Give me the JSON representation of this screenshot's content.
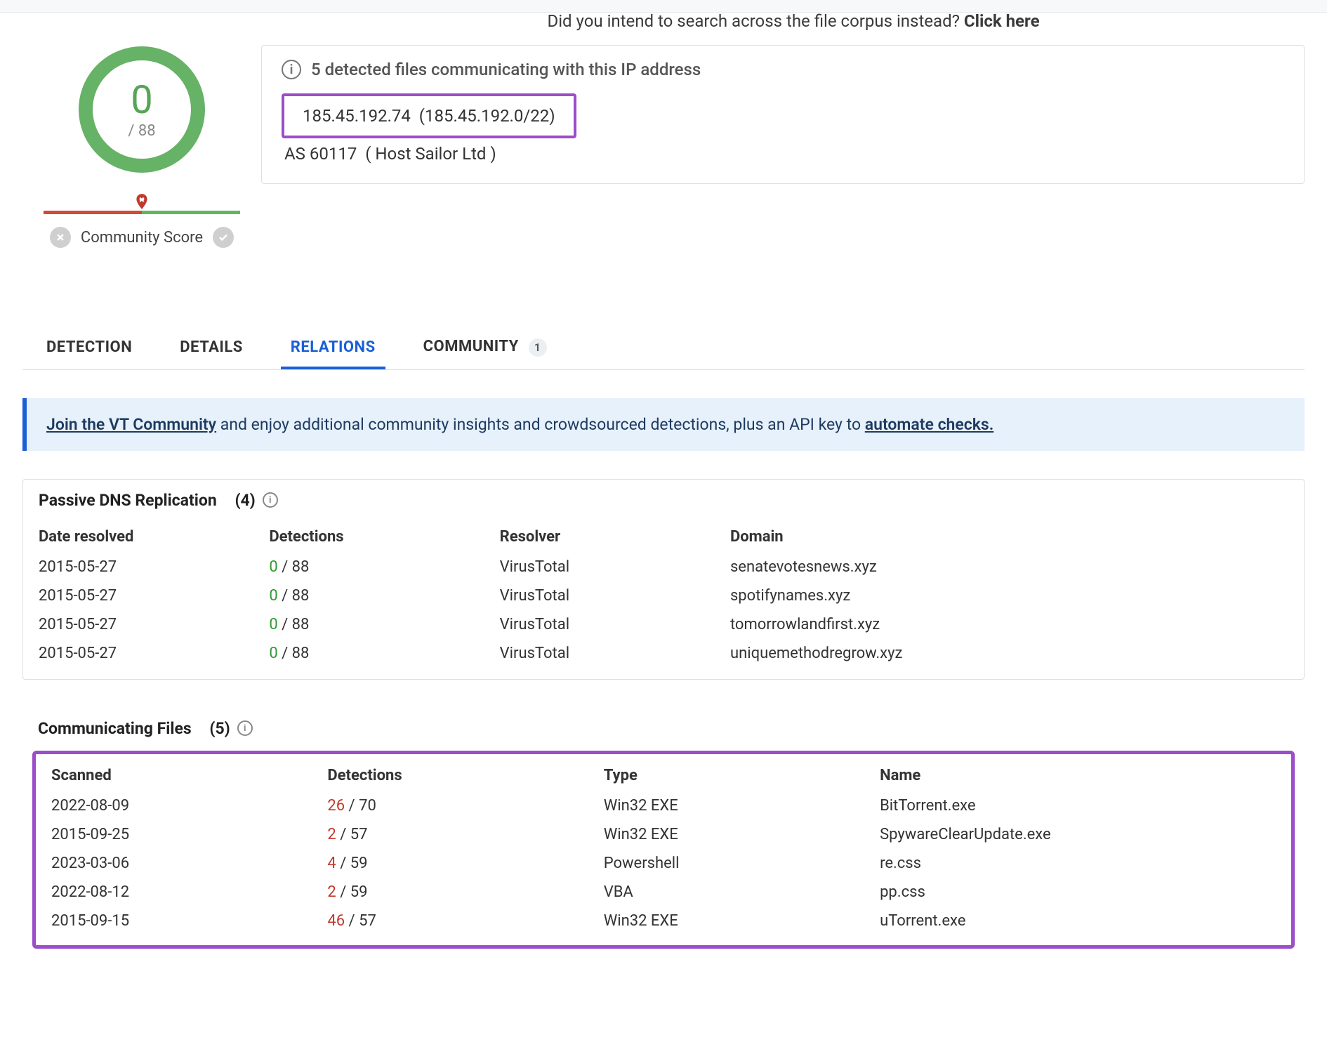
{
  "topHint": {
    "text": "Did you intend to search across the file corpus instead?",
    "linkText": "Click here"
  },
  "score": {
    "detected": "0",
    "total": "/ 88",
    "communityLabel": "Community Score"
  },
  "infoPanel": {
    "notice": "5 detected files communicating with this IP address",
    "ip": "185.45.192.74",
    "cidr": "(185.45.192.0/22)",
    "asn": "AS 60117",
    "asName": "( Host Sailor Ltd )"
  },
  "tabs": {
    "detection": "DETECTION",
    "details": "DETAILS",
    "relations": "RELATIONS",
    "community": "COMMUNITY",
    "communityBadge": "1"
  },
  "promo": {
    "linkA": "Join the VT Community",
    "middle": " and enjoy additional community insights and crowdsourced detections, plus an API key to ",
    "linkB": "automate checks."
  },
  "passiveDns": {
    "title": "Passive DNS Replication",
    "count": "(4)",
    "headers": {
      "date": "Date resolved",
      "det": "Detections",
      "resolver": "Resolver",
      "domain": "Domain"
    },
    "rows": [
      {
        "date": "2015-05-27",
        "det": "0",
        "total": " / 88",
        "resolver": "VirusTotal",
        "domain": "senatevotesnews.xyz"
      },
      {
        "date": "2015-05-27",
        "det": "0",
        "total": " / 88",
        "resolver": "VirusTotal",
        "domain": "spotifynames.xyz"
      },
      {
        "date": "2015-05-27",
        "det": "0",
        "total": " / 88",
        "resolver": "VirusTotal",
        "domain": "tomorrowlandfirst.xyz"
      },
      {
        "date": "2015-05-27",
        "det": "0",
        "total": " / 88",
        "resolver": "VirusTotal",
        "domain": "uniquemethodregrow.xyz"
      }
    ]
  },
  "commFiles": {
    "title": "Communicating Files",
    "count": "(5)",
    "headers": {
      "scanned": "Scanned",
      "det": "Detections",
      "type": "Type",
      "name": "Name"
    },
    "rows": [
      {
        "scanned": "2022-08-09",
        "det": "26",
        "total": " / 70",
        "type": "Win32 EXE",
        "name": "BitTorrent.exe"
      },
      {
        "scanned": "2015-09-25",
        "det": "2",
        "total": " / 57",
        "type": "Win32 EXE",
        "name": "SpywareClearUpdate.exe"
      },
      {
        "scanned": "2023-03-06",
        "det": "4",
        "total": " / 59",
        "type": "Powershell",
        "name": "re.css"
      },
      {
        "scanned": "2022-08-12",
        "det": "2",
        "total": " / 59",
        "type": "VBA",
        "name": "pp.css"
      },
      {
        "scanned": "2015-09-15",
        "det": "46",
        "total": " / 57",
        "type": "Win32 EXE",
        "name": "uTorrent.exe"
      }
    ]
  }
}
